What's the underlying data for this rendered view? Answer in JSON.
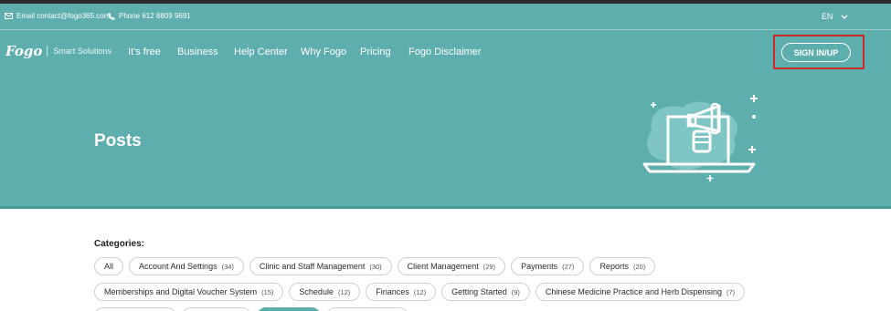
{
  "contact": {
    "email": "Email contact@fogo365.com",
    "phone": "Phone 612 8809 9691"
  },
  "language": {
    "current": "EN"
  },
  "brand": {
    "name": "Fogo",
    "tagline": "Smart Solutions"
  },
  "nav": {
    "items": [
      {
        "label": "It's free"
      },
      {
        "label": "Business"
      },
      {
        "label": "Help Center"
      },
      {
        "label": "Why Fogo"
      },
      {
        "label": "Pricing"
      },
      {
        "label": "Fogo Disclaimer"
      }
    ],
    "sign_in_label": "SIGN IN/UP"
  },
  "hero": {
    "title": "Posts"
  },
  "categories": {
    "label": "Categories:",
    "row1": [
      {
        "label": "All",
        "count": ""
      },
      {
        "label": "Account And Settings",
        "count": "(34)"
      },
      {
        "label": "Clinic and Staff Management",
        "count": "(30)"
      },
      {
        "label": "Client Management",
        "count": "(29)"
      },
      {
        "label": "Payments",
        "count": "(27)"
      },
      {
        "label": "Reports",
        "count": "(20)"
      }
    ],
    "row2": [
      {
        "label": "Memberships and Digital Voucher System",
        "count": "(15)"
      },
      {
        "label": "Schedule",
        "count": "(12)"
      },
      {
        "label": "Finances",
        "count": "(12)"
      },
      {
        "label": "Getting Started",
        "count": "(9)"
      },
      {
        "label": "Chinese Medicine Practice and Herb Dispensing",
        "count": "(7)"
      }
    ]
  },
  "colors": {
    "hero": "#5eaeae",
    "highlight_frame": "#cc2a2a"
  },
  "icons": [
    "mail-icon",
    "phone-icon",
    "chevron-down-icon",
    "megaphone-laptop-illustration"
  ]
}
